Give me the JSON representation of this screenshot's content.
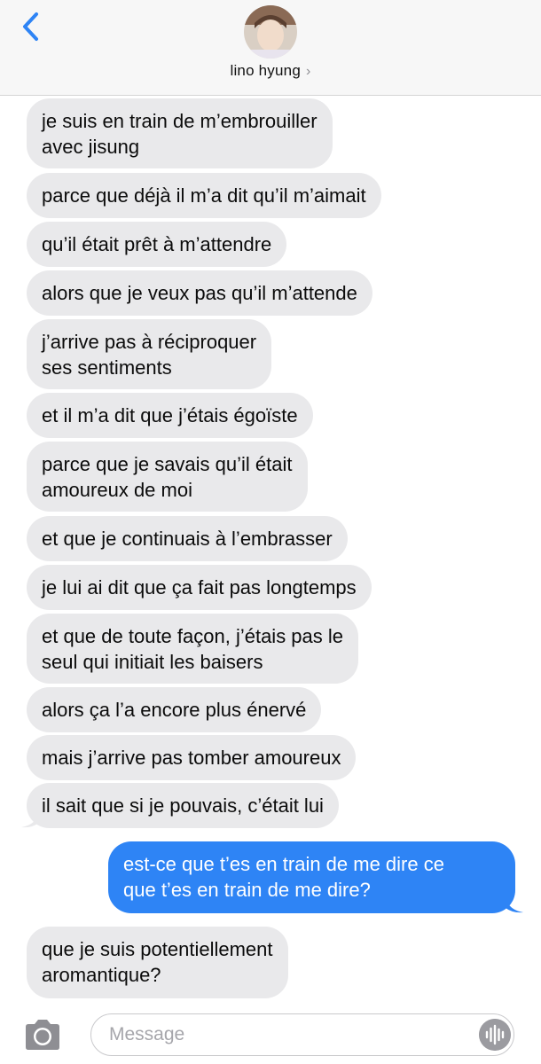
{
  "header": {
    "contact_name": "lino hyung",
    "chevron": "›",
    "back_icon": "chevron-left-icon",
    "accent": "#2e84f5"
  },
  "messages": [
    {
      "dir": "received",
      "text": "je suis en train de m’embrouiller\navec jisung"
    },
    {
      "dir": "received",
      "text": "parce que déjà il m’a dit qu’il m’aimait"
    },
    {
      "dir": "received",
      "text": "qu’il était prêt à m’attendre"
    },
    {
      "dir": "received",
      "text": "alors que je veux pas qu’il m’attende"
    },
    {
      "dir": "received",
      "text": "j’arrive pas à réciproquer\nses sentiments"
    },
    {
      "dir": "received",
      "text": "et il m’a dit que j’étais égoïste"
    },
    {
      "dir": "received",
      "text": "parce que je savais qu’il était\namoureux de moi"
    },
    {
      "dir": "received",
      "text": "et que je continuais à l’embrasser"
    },
    {
      "dir": "received",
      "text": "je lui ai dit que ça fait pas longtemps"
    },
    {
      "dir": "received",
      "text": "et que de toute façon, j’étais pas le\nseul qui initiait les baisers"
    },
    {
      "dir": "received",
      "text": "alors ça l’a encore plus énervé"
    },
    {
      "dir": "received",
      "text": "mais j’arrive pas tomber amoureux"
    },
    {
      "dir": "received",
      "text": "il sait que si je pouvais, c’était lui"
    },
    {
      "dir": "sent",
      "text": "est-ce que t’es en train de me dire ce\nque t’es en train de me dire?"
    },
    {
      "dir": "received",
      "text": "que je suis potentiellement\naromantique?"
    }
  ],
  "composer": {
    "placeholder": "Message",
    "camera_icon": "camera-icon",
    "audio_icon": "audio-waveform-icon"
  },
  "colors": {
    "received_bubble": "#e9e9eb",
    "sent_bubble": "#2e84f5"
  }
}
